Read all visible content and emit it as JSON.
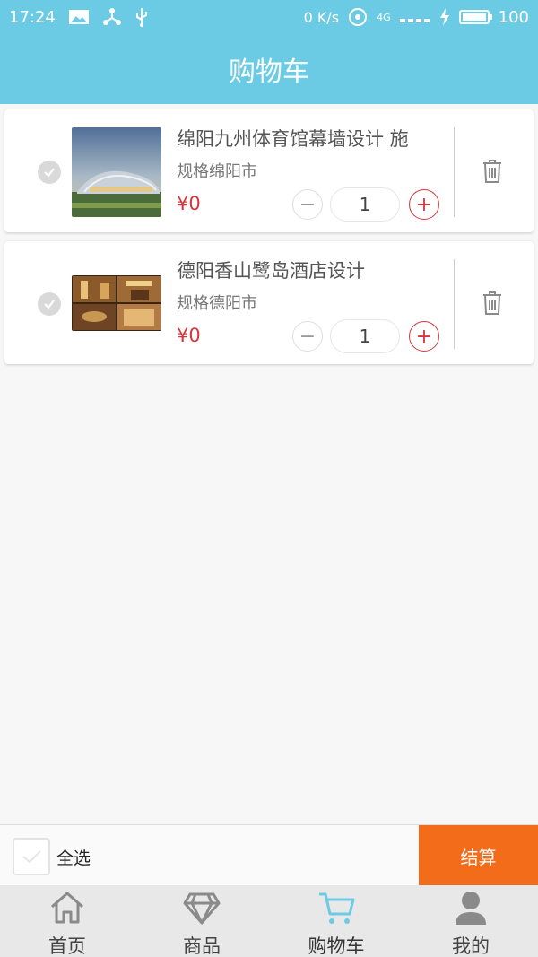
{
  "status": {
    "time": "17:24",
    "speed": "0 K/s",
    "network": "4G",
    "battery": "100"
  },
  "header": {
    "title": "购物车"
  },
  "cart": {
    "items": [
      {
        "title": "绵阳九州体育馆幕墙设计 施",
        "spec": "规格绵阳市",
        "price": "¥0",
        "qty": "1"
      },
      {
        "title": "德阳香山鹭岛酒店设计",
        "spec": "规格德阳市",
        "price": "¥0",
        "qty": "1"
      }
    ],
    "minus_label": "−",
    "plus_label": "+"
  },
  "footer": {
    "select_all": "全选",
    "checkout": "结算"
  },
  "tabs": [
    {
      "label": "首页",
      "icon": "home-icon"
    },
    {
      "label": "商品",
      "icon": "diamond-icon"
    },
    {
      "label": "购物车",
      "icon": "cart-icon",
      "active": true
    },
    {
      "label": "我的",
      "icon": "user-icon"
    }
  ],
  "colors": {
    "primary": "#6ccbe4",
    "price": "#d8343a",
    "checkout": "#f26c1a"
  }
}
